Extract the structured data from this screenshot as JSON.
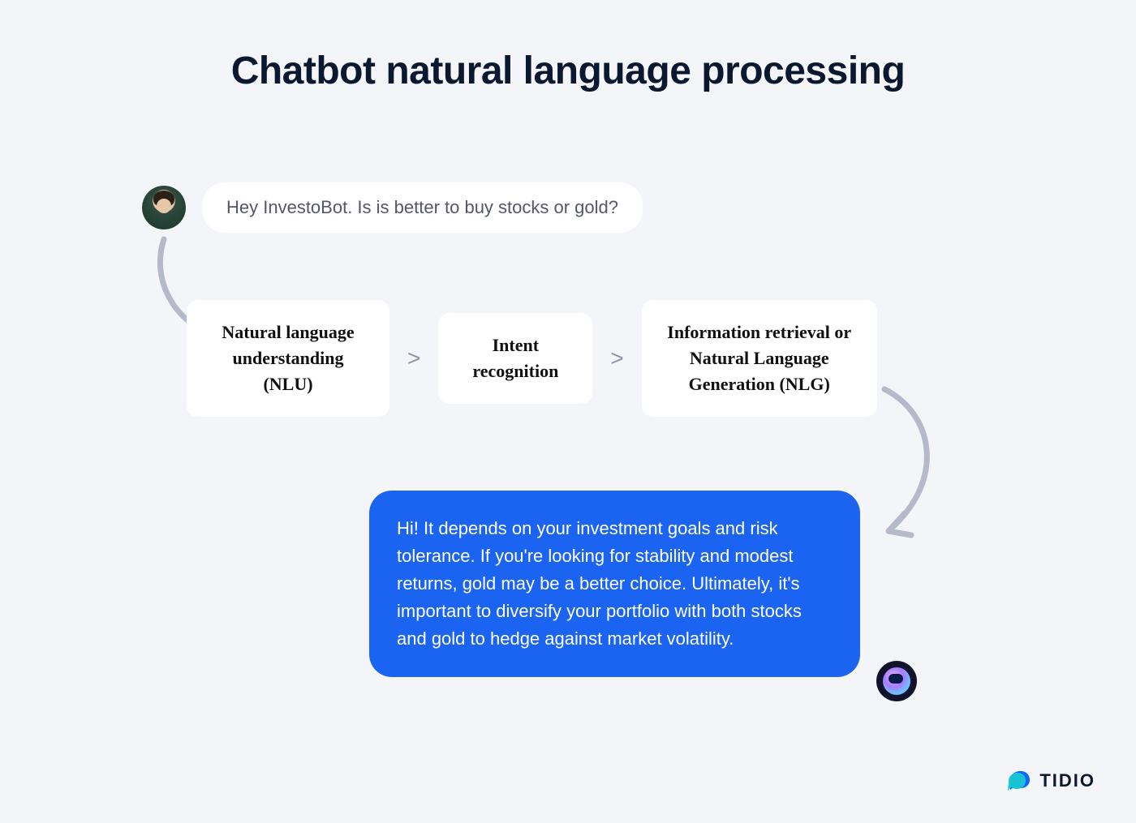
{
  "title": "Chatbot natural language processing",
  "user_message": "Hey InvestoBot. Is is better to buy stocks or gold?",
  "steps": {
    "nlu": "Natural language understanding (NLU)",
    "intent": "Intent recognition",
    "nlg": "Information retrieval or Natural Language Generation (NLG)"
  },
  "bot_message": "Hi! It depends on your investment goals and risk tolerance. If you're looking for stability and modest returns, gold may be a better choice. Ultimately, it's important to diversify your portfolio with both stocks and gold to hedge against market volatility.",
  "brand": "TIDIO"
}
